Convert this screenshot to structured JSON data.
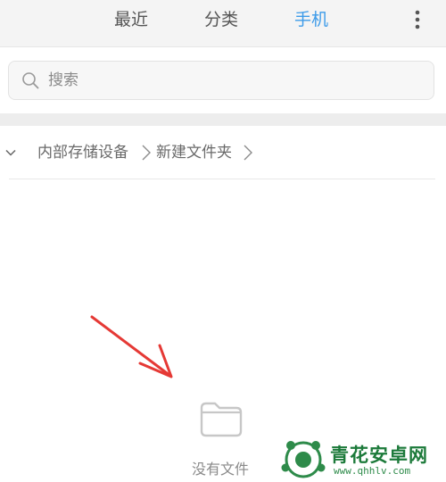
{
  "tabs": [
    {
      "label": "最近",
      "active": false
    },
    {
      "label": "分类",
      "active": false
    },
    {
      "label": "手机",
      "active": true
    }
  ],
  "colors": {
    "accent": "#3d9be9",
    "header_bg": "#f4f4f4",
    "annotation_arrow": "#e53935",
    "watermark_green": "#1c7a3a"
  },
  "icons": {
    "more": "more-vertical-icon",
    "search": "search-icon",
    "collapse": "chevron-down-icon",
    "breadcrumb_separator": "chevron-right-icon",
    "empty_state": "folder-icon"
  },
  "search": {
    "placeholder": "搜索",
    "value": ""
  },
  "breadcrumb": {
    "items": [
      "内部存储设备",
      "新建文件夹"
    ]
  },
  "empty_state": {
    "message": "没有文件"
  },
  "watermark": {
    "title": "青花安卓网",
    "url": "www.qhhlv.com"
  }
}
